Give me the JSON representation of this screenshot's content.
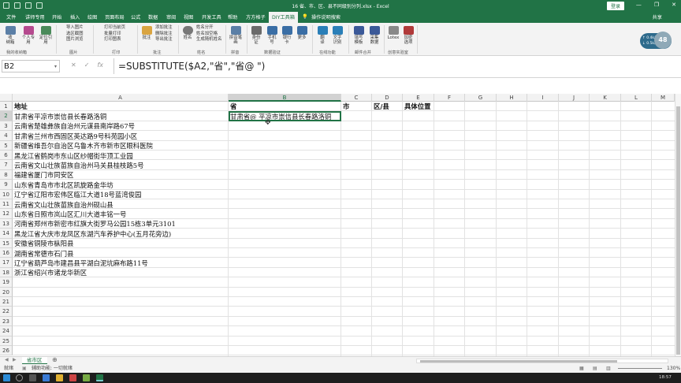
{
  "window": {
    "title": "16 省、市、区、县不同级别分列.xlsx - Excel",
    "login_button": "登录",
    "minimize": "—",
    "restore": "❐",
    "close": "✕"
  },
  "tabs": [
    "文件",
    "讲师专用",
    "开始",
    "插入",
    "绘图",
    "页面布局",
    "公式",
    "数据",
    "审阅",
    "视图",
    "开发工具",
    "帮助",
    "方方格子",
    "DIY工具箱"
  ],
  "tell_me": "操作说明搜索",
  "share": "共享",
  "ribbon": {
    "buttons": [
      {
        "label": "收\n纳箱",
        "color": "#5b7fa6"
      },
      {
        "label": "个人专\n用",
        "color": "#b54a8e"
      },
      {
        "label": "定位引\n用",
        "color": "#4a8a5a"
      },
      {
        "label": "姓名",
        "color": "#777"
      },
      {
        "label": "拼音笔\n画",
        "color": "#5b7fa6"
      },
      {
        "label": "身份\n证",
        "color": "#6b6b6b"
      },
      {
        "label": "手机\n号",
        "color": "#3a6ea5"
      },
      {
        "label": "银行\n卡",
        "color": "#3a6ea5"
      },
      {
        "label": "更多",
        "color": "#3a6ea5"
      },
      {
        "label": "翻\n译",
        "color": "#2a7fb8"
      },
      {
        "label": "文字\n识别",
        "color": "#2a7fb8"
      },
      {
        "label": "填写\n模板",
        "color": "#3b5998"
      },
      {
        "label": "采集\n数据",
        "color": "#3b5998"
      },
      {
        "label": "Lotex",
        "color": "#888"
      },
      {
        "label": "加密\n选项",
        "color": "#b03a3a"
      }
    ],
    "small_items": {
      "image": [
        "导入图片",
        "选区截图",
        "图片浏览"
      ],
      "print": [
        "打印当前页",
        "批量打印",
        "打印图表"
      ],
      "annot": [
        "添加批注",
        "删除批注",
        "导出批注"
      ],
      "names": [
        "姓名分开",
        "姓名加空格",
        "生成随机姓名"
      ]
    },
    "groups": [
      "我的收纳箱",
      "图片",
      "打印",
      "批注",
      "姓名",
      "拼音",
      "数据验证",
      "在线功能",
      "邮件合并",
      "创意实验室"
    ],
    "speed": {
      "up": "↑ 0.4k/s",
      "down": "↓ 0.5k/s"
    },
    "percent": "48"
  },
  "namebox": "B2",
  "formula": "=SUBSTITUTE($A2,\"省\",\"省@    \")",
  "columns": [
    "A",
    "B",
    "C",
    "D",
    "E",
    "F",
    "G",
    "H",
    "I",
    "J",
    "K",
    "L",
    "M"
  ],
  "rows": [
    "1",
    "2",
    "3",
    "4",
    "5",
    "6",
    "7",
    "8",
    "9",
    "10",
    "11",
    "12",
    "13",
    "14",
    "15",
    "16",
    "17",
    "18",
    "19",
    "20",
    "21",
    "22",
    "23",
    "24",
    "25",
    "26"
  ],
  "headers": {
    "A": "地址",
    "B": "省",
    "C": "市",
    "D": "区/县",
    "E": "具体位置"
  },
  "addresses": [
    "甘肃省平凉市崇信县长春路洛铜",
    "云南省楚雄彝族自治州元谋县南岸路67号",
    "甘肃省兰州市西固区英达路9号科苑园小区",
    "新疆省维吾尔自治区乌鲁木齐市新市区眼科医院",
    "黑龙江省鹤岗市东山区纱帽街华顶工业园",
    "云南省文山壮族苗族自治州马关县桂枝路5号",
    "福建省厦门市同安区",
    "山东省青岛市市北区凯旋路金华坊",
    "辽宁省辽阳市宏伟区临江大道18号蓝湾俊园",
    "云南省文山壮族苗族自治州砚山县",
    "山东省日照市岚山区汇川大道丰铭一号",
    "河南省郑州市新密市红旗大街罗马公园15栋3单元3101",
    "黑龙江省大庆市龙凤区东湖汽车养护中心(五月花旁边)",
    "安徽省铜陵市枞阳县",
    "湖南省常德市石门县",
    "辽宁省葫芦岛市建昌县平湖白泥坑麻布路11号",
    "浙江省绍兴市诸龙华新区"
  ],
  "b2_value": "甘肃省@    平凉市崇信县长春路洛铜",
  "sheet_tab": "省市区",
  "status": {
    "left": "就绪",
    "accessibility": "辅助功能: 一切就绪",
    "zoom": "130%"
  },
  "clock": "18:57"
}
